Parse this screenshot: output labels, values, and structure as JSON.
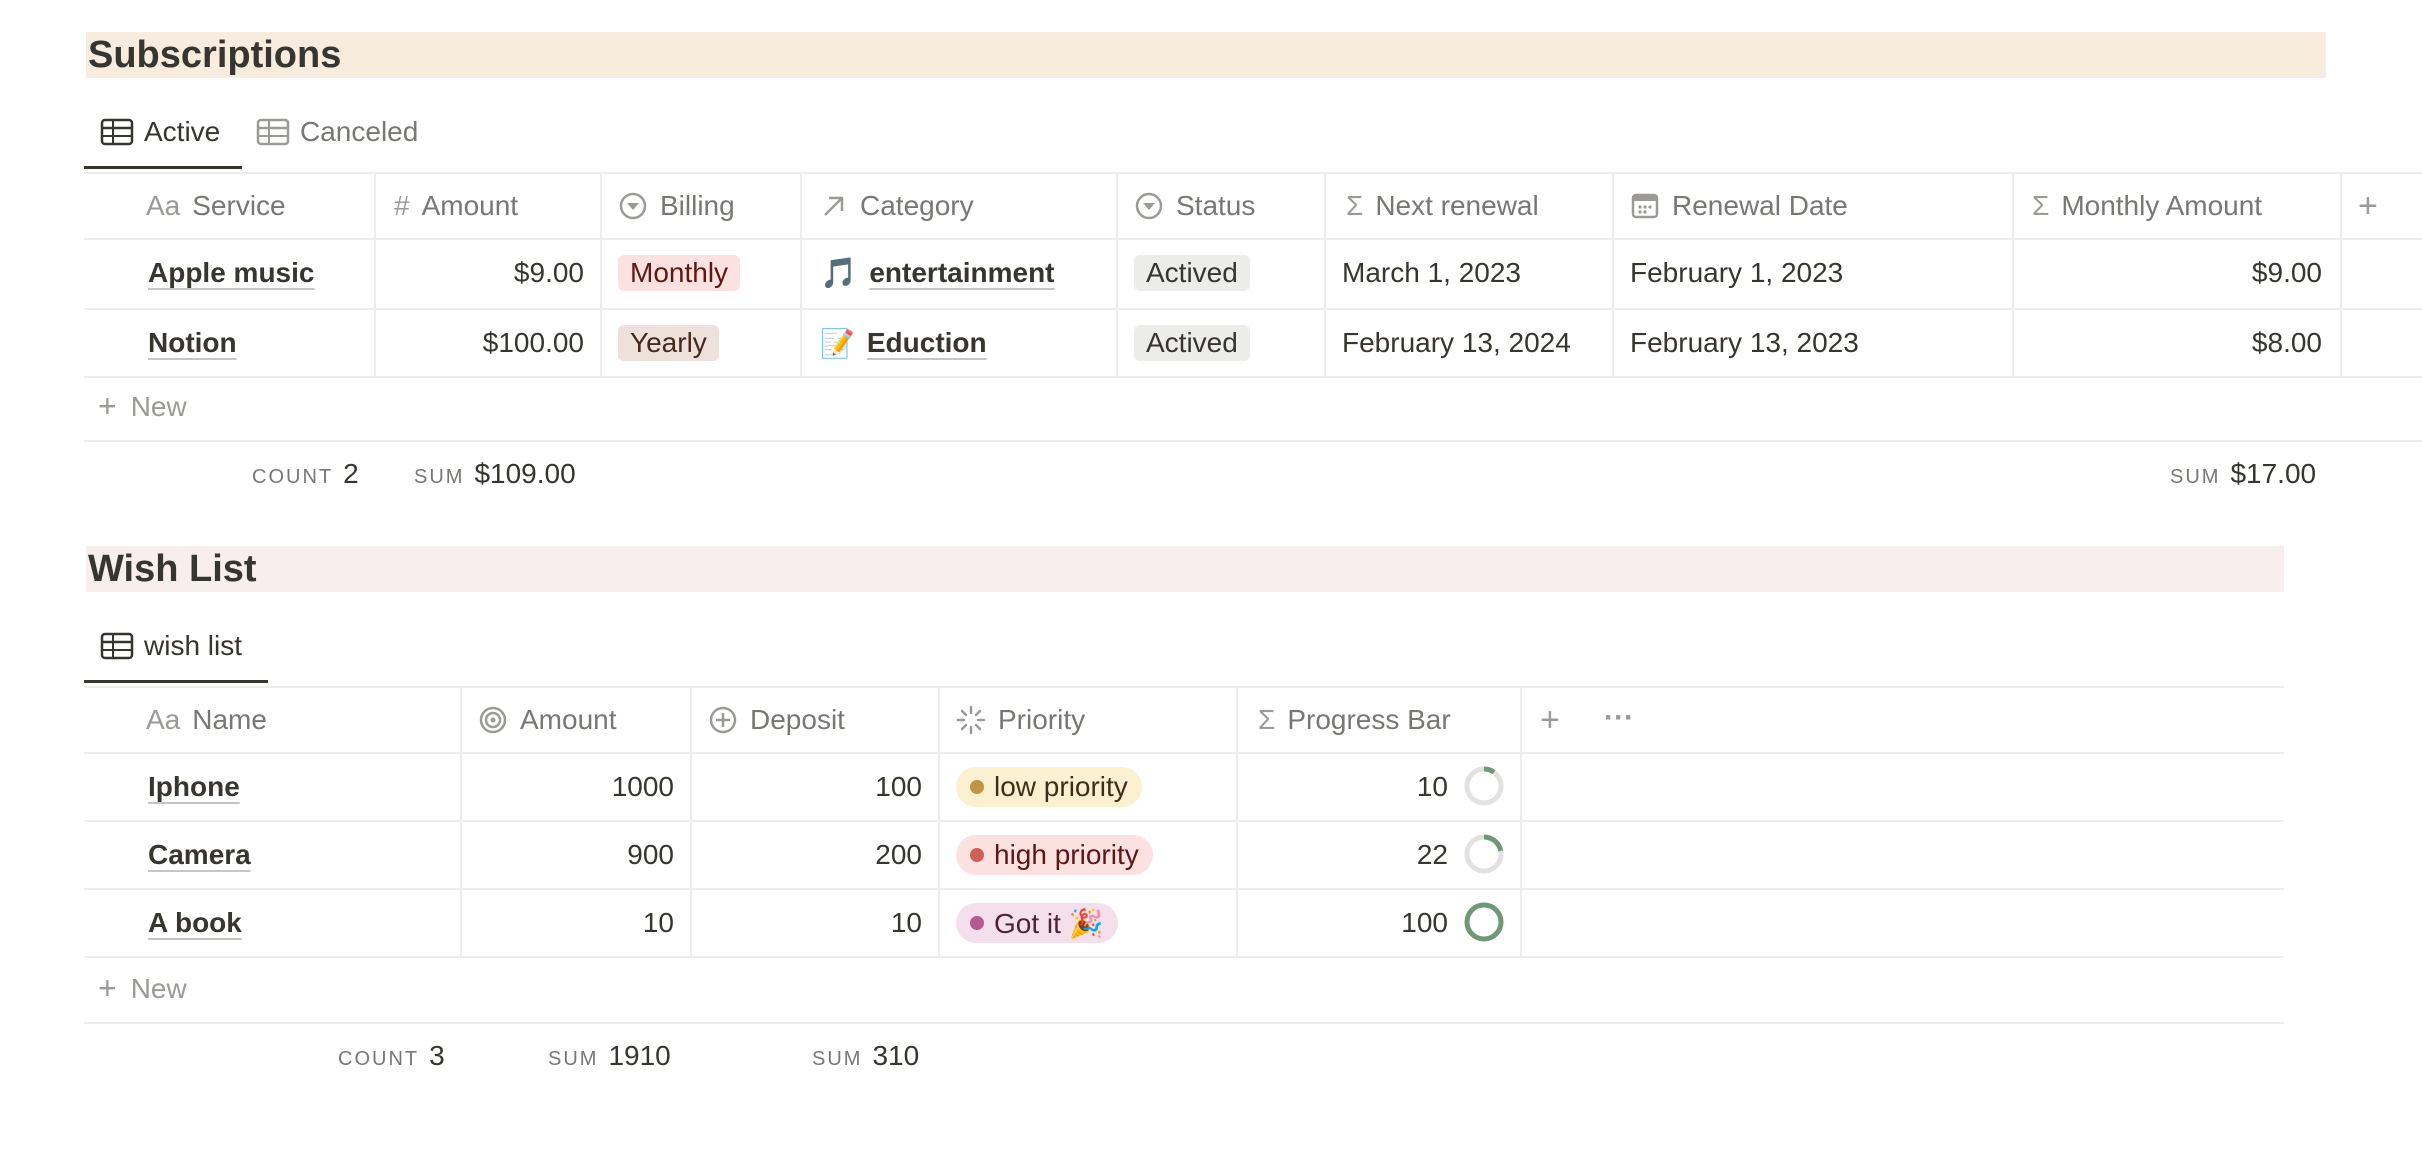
{
  "colors": {
    "subs_banner": "#f8ecdf",
    "wish_banner": "#f8eeee",
    "monthly_bg": "#fbe1e0",
    "yearly_bg": "#eee0da",
    "actived_bg": "#ececeb",
    "low_bg": "#fbf1d0",
    "low_dot": "#c29343",
    "high_bg": "#fbe1e0",
    "high_dot": "#d06055",
    "got_bg": "#f4e0ec",
    "got_dot": "#b45b93",
    "ring_fg": "#6f9876",
    "ring_bg": "#e3e2e0"
  },
  "subscriptions": {
    "title": "Subscriptions",
    "tabs": [
      {
        "label": "Active",
        "icon": "table-icon",
        "active": true
      },
      {
        "label": "Canceled",
        "icon": "table-icon",
        "active": false
      }
    ],
    "columns": [
      {
        "label": "Service",
        "icon": "Aa"
      },
      {
        "label": "Amount",
        "icon": "#"
      },
      {
        "label": "Billing",
        "icon": "select-icon"
      },
      {
        "label": "Category",
        "icon": "relation-arrow-icon"
      },
      {
        "label": "Status",
        "icon": "select-icon"
      },
      {
        "label": "Next renewal",
        "icon": "Σ"
      },
      {
        "label": "Renewal Date",
        "icon": "calendar-icon"
      },
      {
        "label": "Monthly Amount",
        "icon": "Σ"
      }
    ],
    "add_column": "+",
    "rows": [
      {
        "service": "Apple music",
        "amount": "$9.00",
        "billing": "Monthly",
        "category_emoji": "🎵",
        "category": "entertainment",
        "status": "Actived",
        "next_renewal": "March 1, 2023",
        "renewal_date": "February 1, 2023",
        "monthly": "$9.00"
      },
      {
        "service": "Notion",
        "amount": "$100.00",
        "billing": "Yearly",
        "category_emoji": "📝",
        "category": "Eduction",
        "status": "Actived",
        "next_renewal": "February 13, 2024",
        "renewal_date": "February 13, 2023",
        "monthly": "$8.00"
      }
    ],
    "new_label": "New",
    "footer": {
      "count_label": "COUNT",
      "count": "2",
      "sum_label": "SUM",
      "sum_amount": "$109.00",
      "sum_monthly_label": "SUM",
      "sum_monthly": "$17.00"
    }
  },
  "wishlist": {
    "title": "Wish List",
    "tabs": [
      {
        "label": "wish list",
        "icon": "table-icon",
        "active": true
      }
    ],
    "columns": [
      {
        "label": "Name",
        "icon": "Aa"
      },
      {
        "label": "Amount",
        "icon": "target-icon"
      },
      {
        "label": "Deposit",
        "icon": "plus-circle-icon"
      },
      {
        "label": "Priority",
        "icon": "loading-icon"
      },
      {
        "label": "Progress Bar",
        "icon": "Σ"
      }
    ],
    "add_column": "+",
    "more": "···",
    "rows": [
      {
        "name": "Iphone",
        "amount": "1000",
        "deposit": "100",
        "priority": "low priority",
        "priority_tone": "low",
        "progress": "10",
        "progress_value": 10
      },
      {
        "name": "Camera",
        "amount": "900",
        "deposit": "200",
        "priority": "high priority",
        "priority_tone": "high",
        "progress": "22",
        "progress_value": 22
      },
      {
        "name": "A book",
        "amount": "10",
        "deposit": "10",
        "priority": "Got it 🎉",
        "priority_tone": "got",
        "progress": "100",
        "progress_value": 100
      }
    ],
    "new_label": "New",
    "footer": {
      "count_label": "COUNT",
      "count": "3",
      "sum_amount_label": "SUM",
      "sum_amount": "1910",
      "sum_deposit_label": "SUM",
      "sum_deposit": "310"
    }
  }
}
